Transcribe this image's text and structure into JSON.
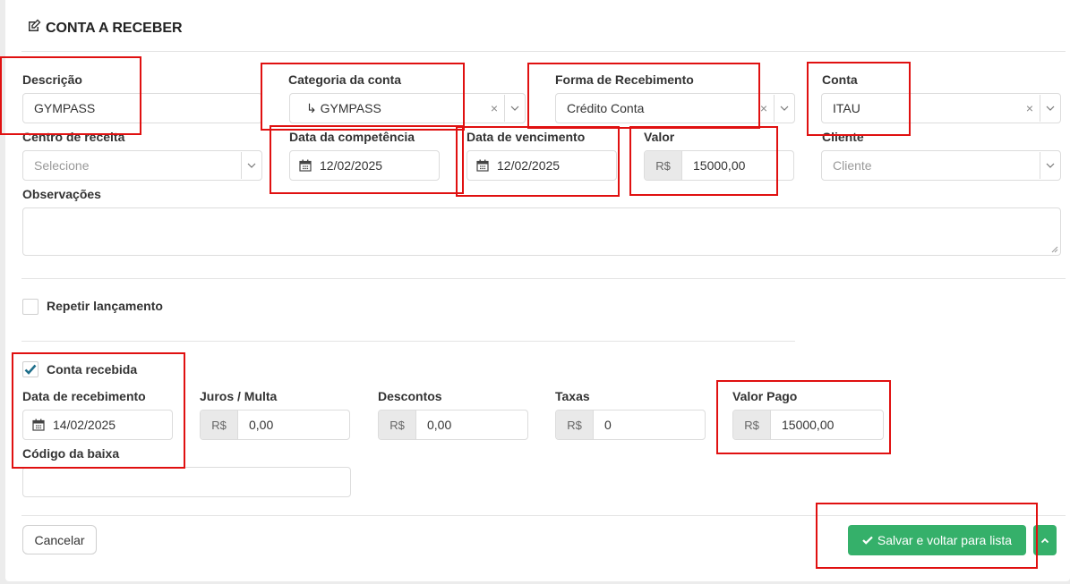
{
  "header": {
    "title": "CONTA A RECEBER",
    "icon": "edit-icon"
  },
  "fields": {
    "descricao": {
      "label": "Descrição",
      "value": "GYMPASS"
    },
    "categoria": {
      "label": "Categoria da conta",
      "value": "↳ GYMPASS"
    },
    "forma_recebimento": {
      "label": "Forma de Recebimento",
      "value": "Crédito Conta"
    },
    "conta": {
      "label": "Conta",
      "value": "ITAU"
    },
    "centro_receita": {
      "label": "Centro de receita",
      "placeholder": "Selecione"
    },
    "data_competencia": {
      "label": "Data da competência",
      "value": "12/02/2025"
    },
    "data_vencimento": {
      "label": "Data de vencimento",
      "value": "12/02/2025"
    },
    "valor": {
      "label": "Valor",
      "prefix": "R$",
      "value": "15000,00"
    },
    "cliente": {
      "label": "Cliente",
      "placeholder": "Cliente"
    },
    "observacoes": {
      "label": "Observações",
      "value": ""
    }
  },
  "repetir": {
    "label": "Repetir lançamento",
    "checked": false
  },
  "recebimento": {
    "conta_recebida": {
      "label": "Conta recebida",
      "checked": true
    },
    "data_recebimento": {
      "label": "Data de recebimento",
      "value": "14/02/2025"
    },
    "juros": {
      "label": "Juros / Multa",
      "prefix": "R$",
      "value": "0,00"
    },
    "descontos": {
      "label": "Descontos",
      "prefix": "R$",
      "value": "0,00"
    },
    "taxas": {
      "label": "Taxas",
      "prefix": "R$",
      "value": "0"
    },
    "valor_pago": {
      "label": "Valor Pago",
      "prefix": "R$",
      "value": "15000,00"
    },
    "codigo_baixa": {
      "label": "Código da baixa",
      "value": ""
    }
  },
  "footer": {
    "cancel_label": "Cancelar",
    "save_label": "Salvar e voltar para lista"
  },
  "colors": {
    "primary": "#35b06a",
    "highlight": "#e01010",
    "checkbox": "#1f6f8b"
  }
}
